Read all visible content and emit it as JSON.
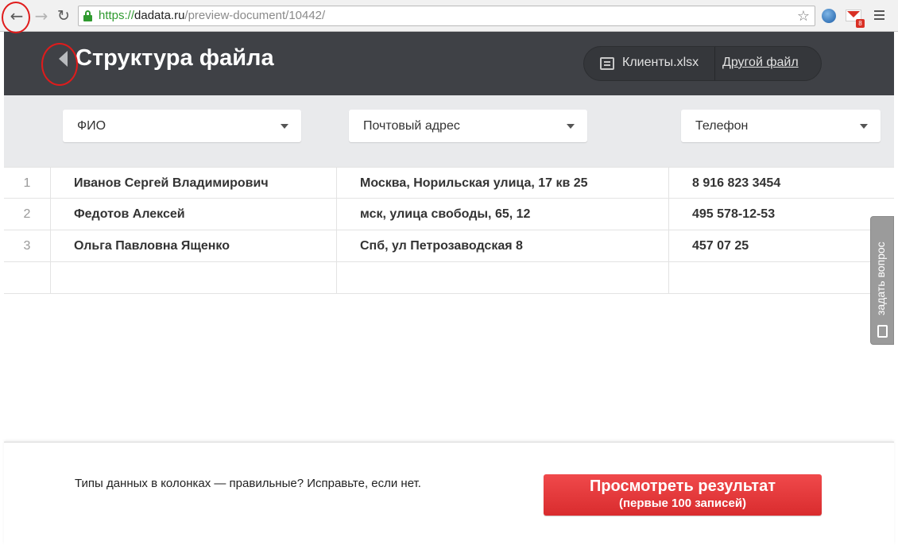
{
  "browser": {
    "url_scheme": "https://",
    "url_host": "dadata.ru",
    "url_path": "/preview-document/10442/",
    "gmail_badge": "8",
    "icons": [
      "back-icon",
      "forward-icon",
      "reload-icon",
      "lock-icon",
      "star-icon",
      "globe-icon",
      "gmail-icon",
      "menu-icon"
    ]
  },
  "header": {
    "title": "Структура файла",
    "file_name": "Клиенты.xlsx",
    "other_file_link": "Другой файл"
  },
  "columns": [
    {
      "label": "ФИО"
    },
    {
      "label": "Почтовый адрес"
    },
    {
      "label": "Телефон"
    }
  ],
  "rows": [
    {
      "num": "1",
      "name": "Иванов Сергей Владимирович",
      "address": "Москва, Норильская улица, 17 кв 25",
      "phone": "8 916 823 3454"
    },
    {
      "num": "2",
      "name": "Федотов Алексей",
      "address": "мск, улица свободы, 65, 12",
      "phone": "495 578-12-53"
    },
    {
      "num": "3",
      "name": "Ольга Павловна Ященко",
      "address": "Спб, ул Петрозаводская 8",
      "phone": "457 07 25"
    },
    {
      "num": "",
      "name": "",
      "address": "",
      "phone": ""
    }
  ],
  "side_tab": {
    "label": "задать вопрос"
  },
  "footer": {
    "note": "Типы данных в колонках — правильные? Исправьте, если нет.",
    "button_line1": "Просмотреть результат",
    "button_line2": "(первые 100 записей)"
  },
  "colors": {
    "header_bg": "#3f4146",
    "selectors_bg": "#e9eaec",
    "primary_button": "#e53b3d",
    "annotation": "#e01b1b"
  }
}
